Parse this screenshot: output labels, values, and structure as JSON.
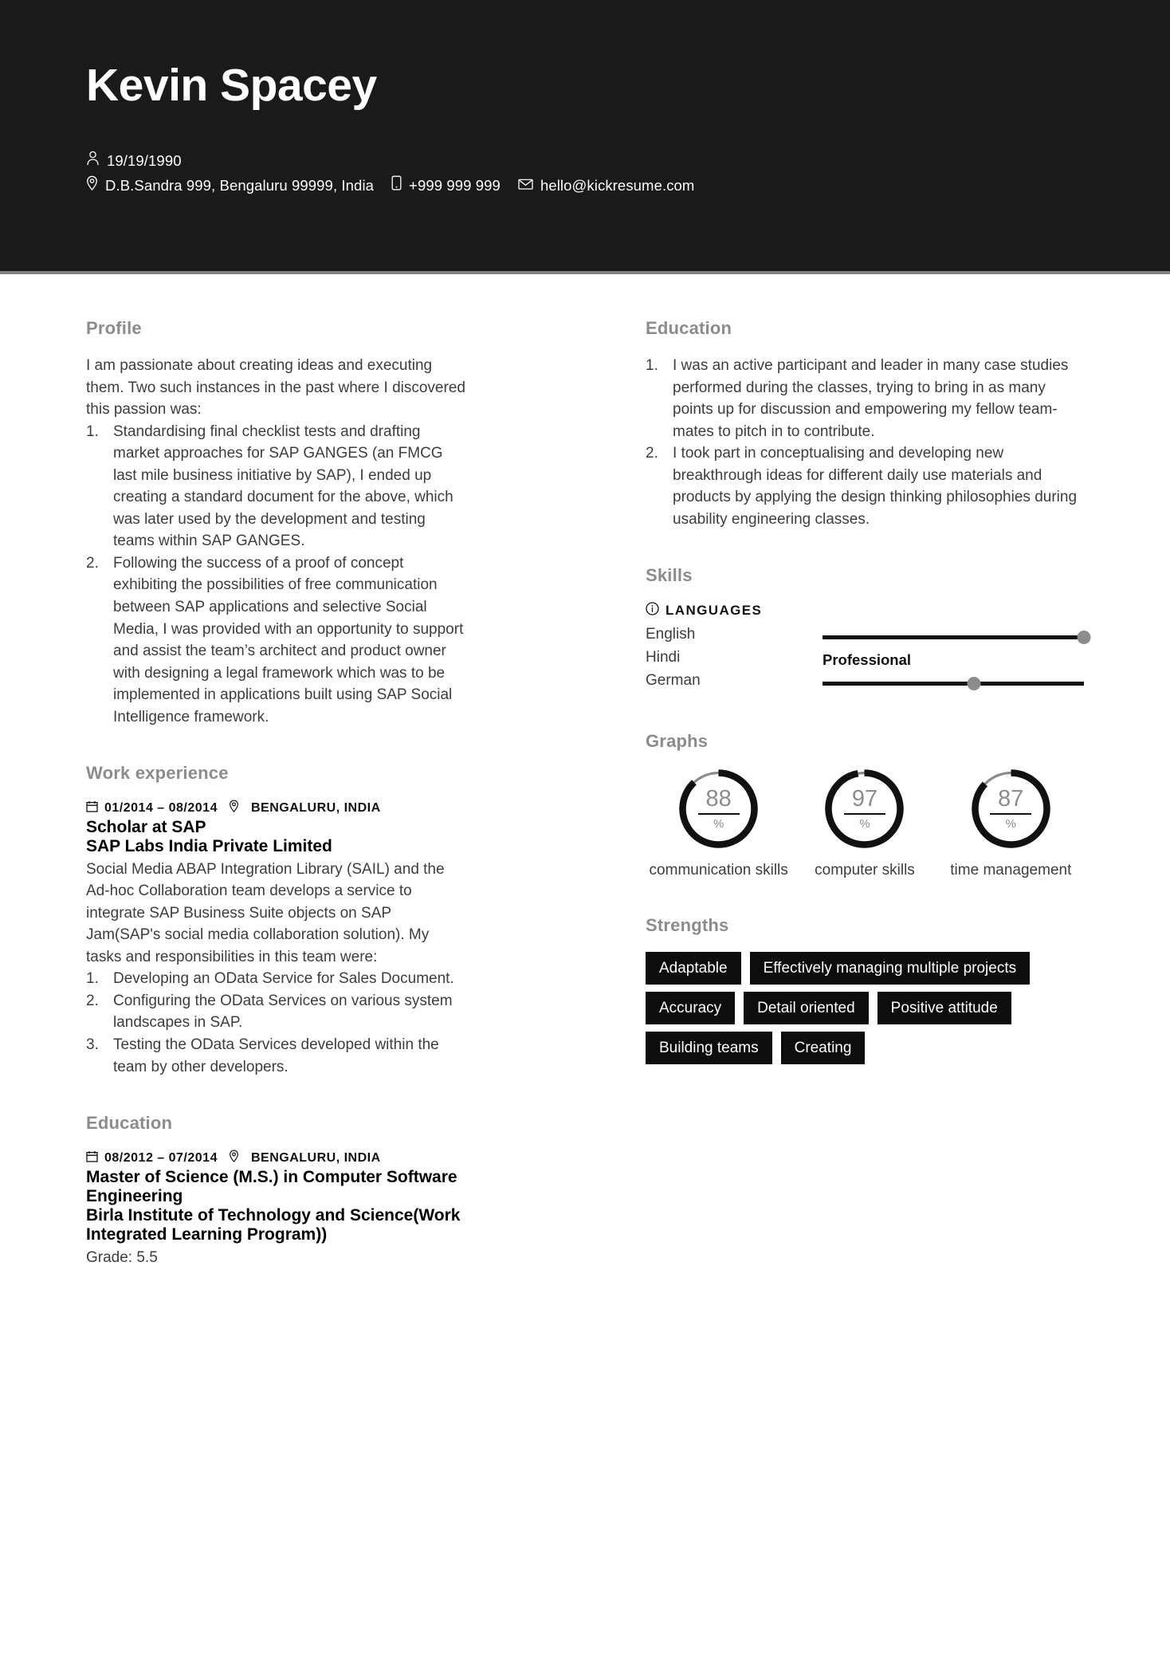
{
  "header": {
    "name": "Kevin Spacey",
    "birthdate": "19/19/1990",
    "address": "D.B.Sandra 999, Bengaluru 99999, India",
    "phone": "+999 999 999",
    "email": "hello@kickresume.com",
    "icons": {
      "person": "person-icon",
      "pin": "map-pin-icon",
      "phone": "phone-icon",
      "mail": "mail-icon"
    },
    "background_color": "#1a1a1a",
    "rule_color": "#808080"
  },
  "left": {
    "profile": {
      "title": "Profile",
      "intro": "I am passionate about creating ideas and executing them. Two such instances in the past where I discovered this passion was:",
      "items": [
        "Standardising final checklist tests and drafting market approaches for SAP GANGES (an FMCG last mile business initiative by SAP), I ended up creating a standard document for the above, which was later used by the development and testing teams within SAP GANGES.",
        "Following the success of a proof of concept exhibiting the possibilities of free communication between SAP applications and selective Social Media, I was provided with an opportunity to support and assist the team’s architect and product owner with designing a legal framework which was to be implemented in applications built using SAP Social Intelligence framework."
      ]
    },
    "work_experience": {
      "title": "Work experience",
      "entries": [
        {
          "dates": "01/2014 – 08/2014",
          "location": "BENGALURU, INDIA",
          "position": "Scholar at SAP",
          "organization": "SAP Labs India Private Limited",
          "description": "Social Media ABAP Integration Library (SAIL) and the Ad-hoc Collaboration team develops a service to integrate SAP Business Suite objects on SAP Jam(SAP's social media collaboration solution). My tasks and responsibilities in this team were:",
          "items": [
            "Developing an OData Service for Sales Document.",
            "Configuring the OData Services on various system landscapes in SAP.",
            "Testing the OData Services developed within the team by other developers."
          ]
        }
      ]
    },
    "education": {
      "title": "Education",
      "entries": [
        {
          "dates": "08/2012 – 07/2014",
          "location": "BENGALURU, INDIA",
          "degree": "Master of Science (M.S.) in Computer Software Engineering",
          "school": "Birla Institute of Technology and Science(Work Integrated Learning Program))",
          "grade": "Grade: 5.5"
        }
      ]
    }
  },
  "right": {
    "education": {
      "title": "Education",
      "items": [
        "I was an active participant and leader in many case studies performed during the classes, trying to bring in as many points up for discussion and empowering my fellow team-mates to pitch in to contribute.",
        "I took part in conceptualising and developing new breakthrough ideas for different daily use materials and products by applying the design thinking philosophies during usability engineering classes."
      ]
    },
    "skills": {
      "title": "Skills",
      "group_label": "LANGUAGES",
      "group_icon": "info-icon",
      "languages": [
        {
          "name": "English",
          "level_percent": 100,
          "level_label": ""
        },
        {
          "name": "Hindi",
          "level_percent": 100,
          "level_label": "Professional"
        },
        {
          "name": "German",
          "level_percent": 58,
          "level_label": ""
        }
      ]
    },
    "graphs": {
      "title": "Graphs"
    },
    "strengths": {
      "title": "Strengths",
      "tags": [
        "Adaptable",
        "Effectively managing multiple projects",
        "Accuracy",
        "Detail oriented",
        "Positive attitude",
        "Building teams",
        "Creating"
      ]
    }
  },
  "chart_data": {
    "type": "pie",
    "title": "Graphs",
    "subtype": "donut-gauge",
    "unit": "%",
    "ylim": [
      0,
      100
    ],
    "categories": [
      "communication skills",
      "computer skills",
      "time management"
    ],
    "values": [
      88,
      97,
      87
    ],
    "series": [
      {
        "name": "skill level",
        "values": [
          88,
          97,
          87
        ]
      }
    ],
    "colors": {
      "filled": "#111111",
      "track": "#8c8c8c",
      "value_text": "#8c8c8c"
    },
    "legend": "none",
    "grid": false
  }
}
